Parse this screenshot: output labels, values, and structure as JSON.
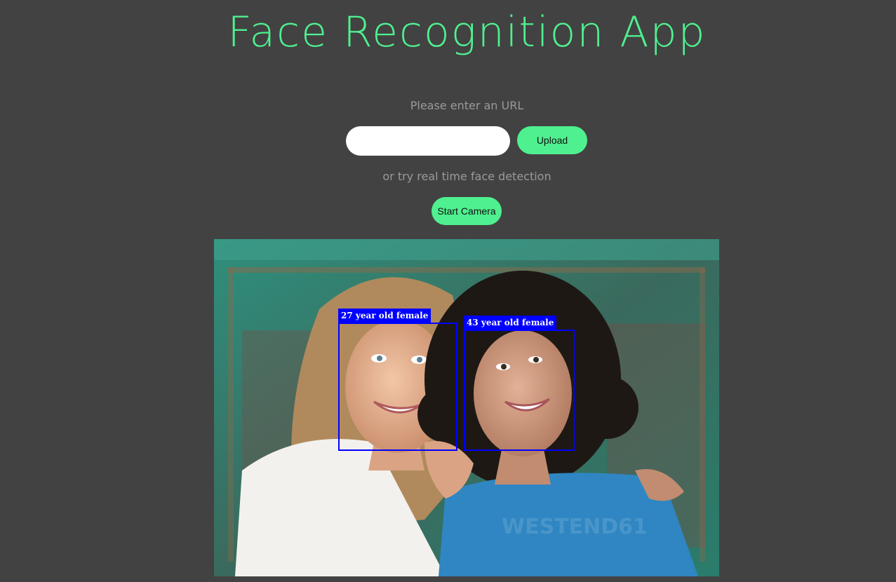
{
  "header": {
    "title": "Face Recognition App"
  },
  "url_form": {
    "prompt": "Please enter an URL",
    "input_value": "",
    "input_placeholder": "",
    "upload_label": "Upload"
  },
  "camera": {
    "prompt": "or try real time face detection",
    "start_label": "Start Camera"
  },
  "detections": [
    {
      "label": "27 year old female"
    },
    {
      "label": "43 year old female"
    }
  ],
  "watermark": "WESTEND61",
  "colors": {
    "background": "#424242",
    "accent": "#4ff08f",
    "prompt_text": "#9a9a9a",
    "box": "#0000ff"
  }
}
